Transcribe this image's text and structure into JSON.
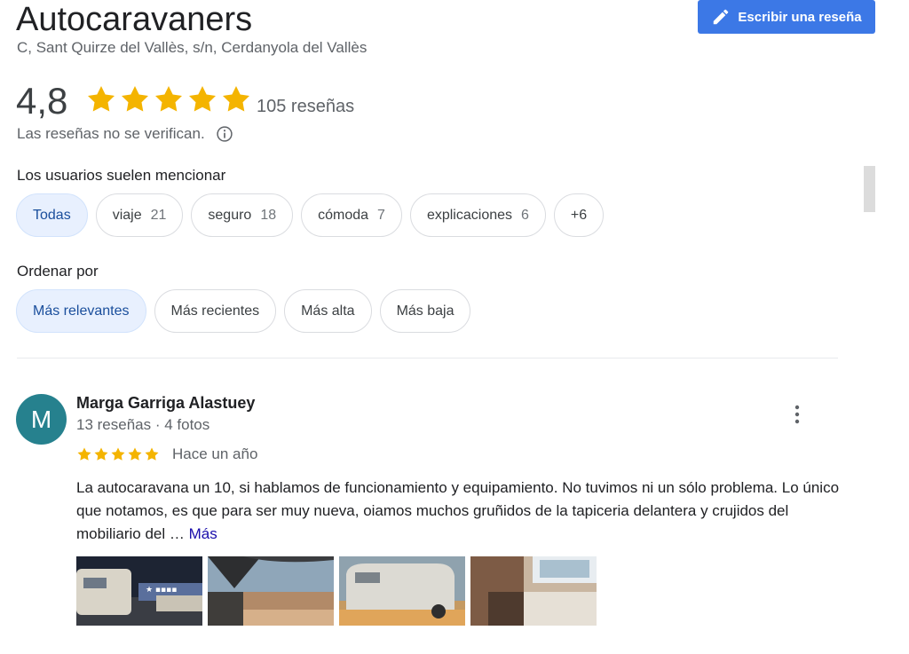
{
  "place": {
    "name": "Autocaravaners",
    "address": "C, Sant Quirze del Vallès, s/n, Cerdanyola del Vallès"
  },
  "write_review_label": "Escribir una reseña",
  "rating": {
    "value": "4,8",
    "stars": 5,
    "count_label": "105 reseñas",
    "verify_note": "Las reseñas no se verifican."
  },
  "mentions": {
    "label": "Los usuarios suelen mencionar",
    "chips": [
      {
        "label": "Todas",
        "count": ""
      },
      {
        "label": "viaje",
        "count": "21"
      },
      {
        "label": "seguro",
        "count": "18"
      },
      {
        "label": "cómoda",
        "count": "7"
      },
      {
        "label": "explicaciones",
        "count": "6"
      },
      {
        "label": "+6",
        "count": ""
      }
    ]
  },
  "sort": {
    "label": "Ordenar por",
    "options": [
      "Más relevantes",
      "Más recientes",
      "Más alta",
      "Más baja"
    ]
  },
  "review": {
    "avatar_letter": "M",
    "name": "Marga Garriga Alastuey",
    "meta": "13 reseñas · 4 fotos",
    "stars": 5,
    "date": "Hace un año",
    "text": "La autocaravana un 10, si hablamos de funcionamiento y equipamiento. No tuvimos ni un sólo problema. Lo único que notamos, es que para ser muy nueva, oiamos muchos gruñidos de la tapiceria delantera y crujidos del mobiliario del … ",
    "more_label": "Más"
  },
  "colors": {
    "accent": "#3c78e6",
    "star": "#f4b400",
    "chip_active_bg": "#e8f0fe",
    "avatar_bg": "#26818e",
    "link": "#1a0dab"
  }
}
